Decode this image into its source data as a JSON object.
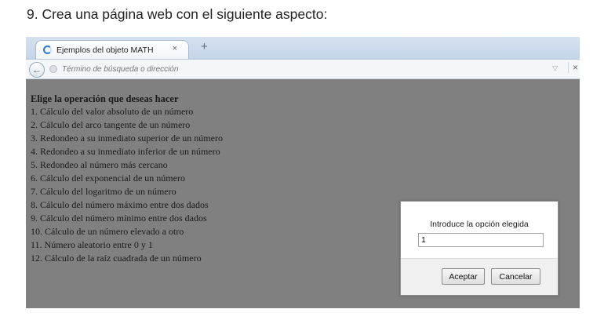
{
  "document": {
    "heading": "9.  Crea una página web con el siguiente aspecto:"
  },
  "browser": {
    "tab": {
      "title": "Ejemplos del objeto MATH",
      "close_glyph": "×"
    },
    "new_tab_glyph": "+",
    "address_bar": {
      "placeholder": "Término de búsqueda o dirección",
      "back_glyph": "←",
      "dropdown_glyph": "▽",
      "stop_glyph": "×"
    }
  },
  "page": {
    "menu_title": "Elige la operación que deseas hacer",
    "options": [
      "1. Cálculo del valor absoluto de un número",
      "2. Cálculo del arco tangente de un número",
      "3. Redondeo a su inmediato superior de un número",
      "4. Redondeo a su inmediato inferior de un número",
      "5. Redondeo al número más cercano",
      "6. Cálculo del exponencial de un número",
      "7. Cálculo del logaritmo de un número",
      "8. Cálculo del número máximo entre dos dados",
      "9. Cálculo del número mínimo entre dos dados",
      "10. Cálculo de un número elevado a otro",
      "11. Número aleatorio entre 0 y 1",
      "12. Cálculo de la raíz cuadrada de un número"
    ]
  },
  "prompt_dialog": {
    "message": "Introduce la opción elegida",
    "input_value": "1",
    "ok_label": "Aceptar",
    "cancel_label": "Cancelar"
  },
  "colors": {
    "page_background": "#808080",
    "tab_spinner": "#2c7ad6"
  }
}
